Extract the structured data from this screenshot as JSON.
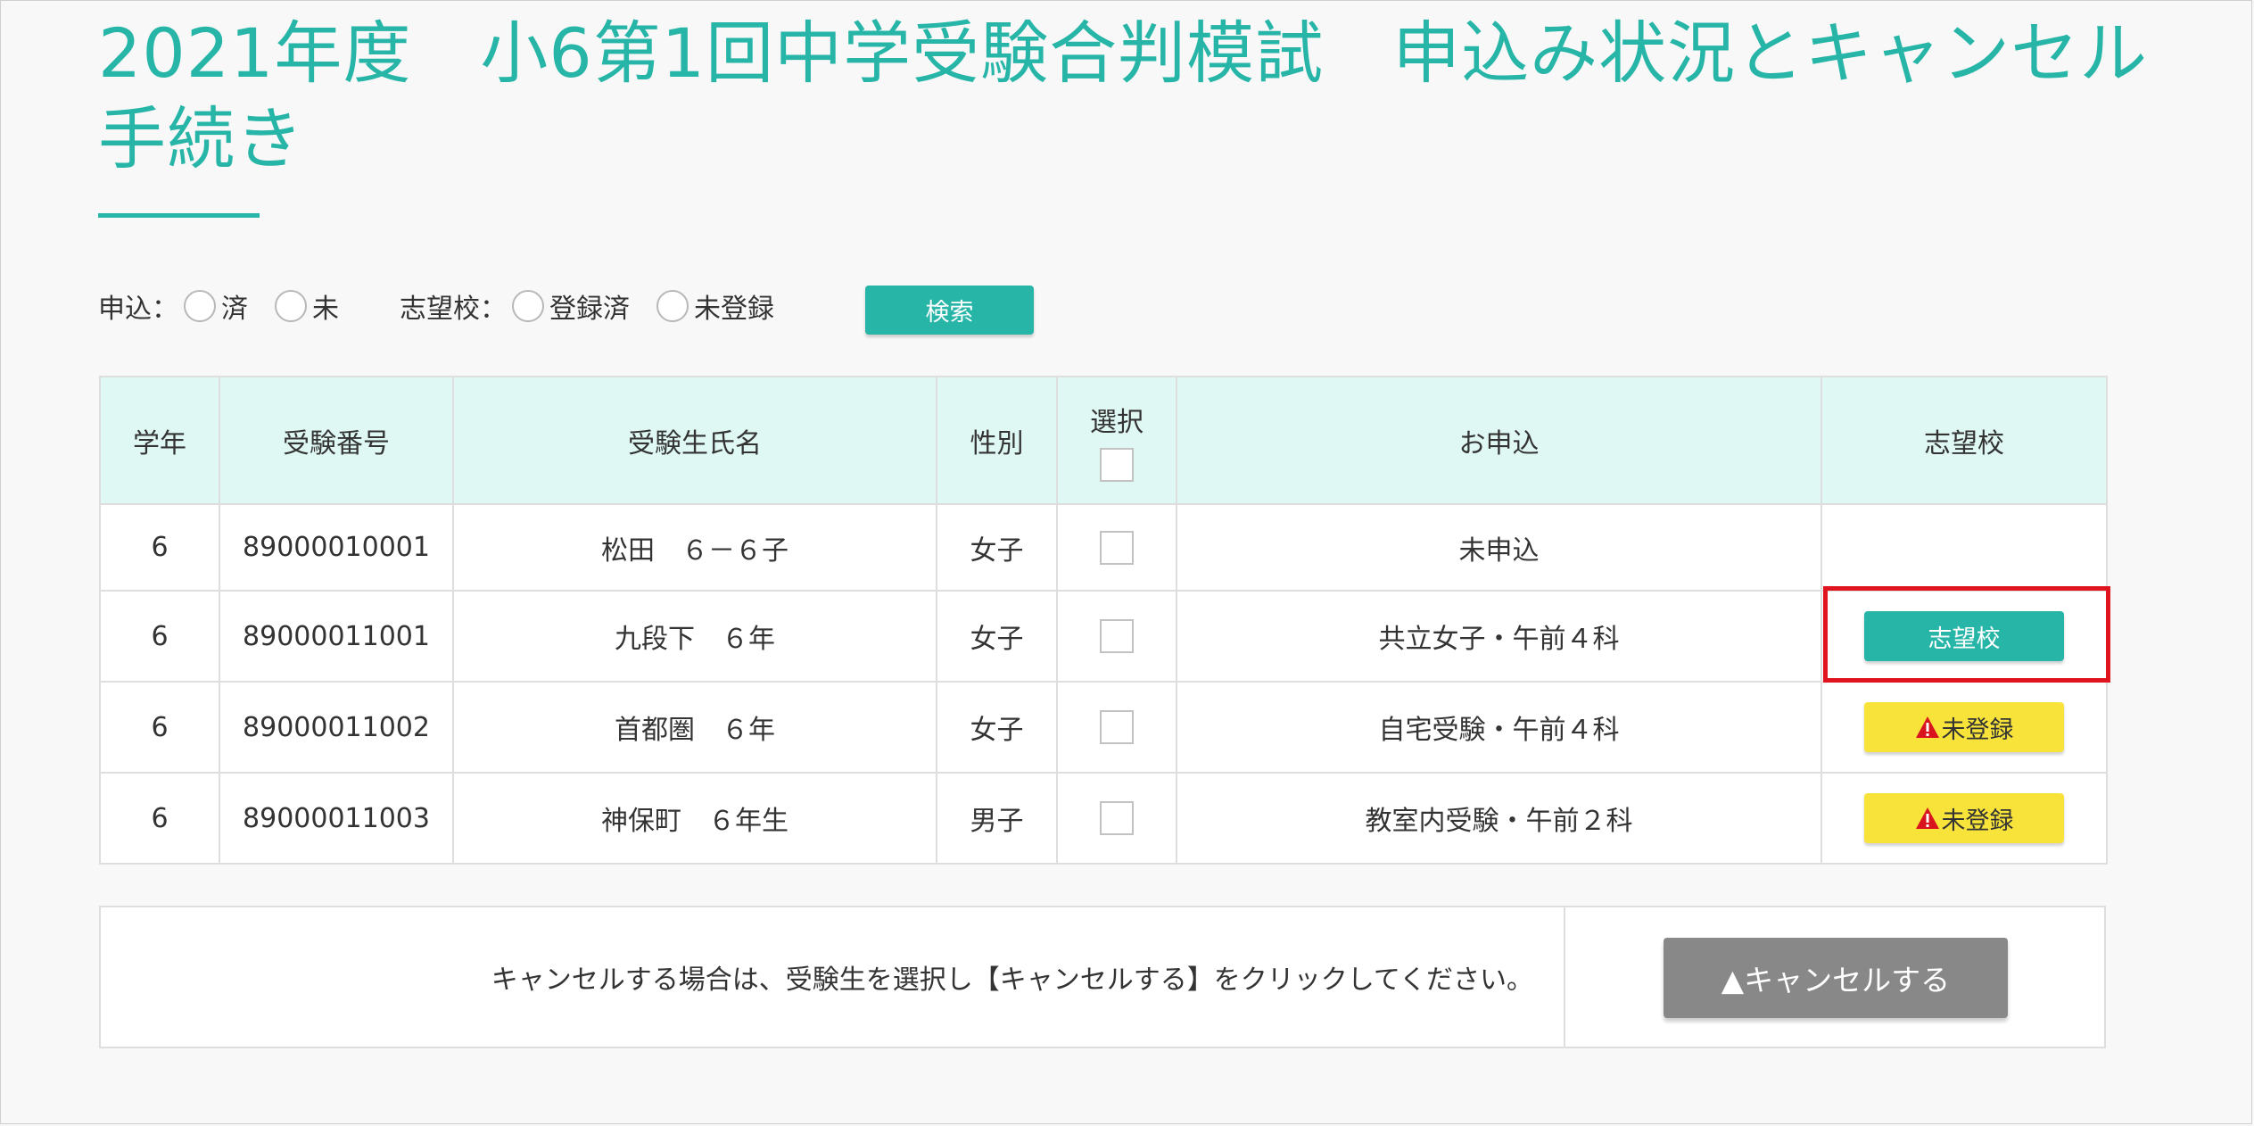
{
  "page": {
    "title": "2021年度　小6第1回中学受験合判模試　申込み状況とキャンセル手続き"
  },
  "filters": {
    "apply_label": "申込：",
    "apply_options": [
      "済",
      "未"
    ],
    "school_label": "志望校：",
    "school_options": [
      "登録済",
      "未登録"
    ],
    "search_button": "検索"
  },
  "table": {
    "headers": {
      "grade": "学年",
      "exam_no": "受験番号",
      "name": "受験生氏名",
      "gender": "性別",
      "select": "選択",
      "application": "お申込",
      "school": "志望校"
    },
    "rows": [
      {
        "grade": "6",
        "exam_no": "89000010001",
        "name": "松田　６－６子",
        "gender": "女子",
        "application": "未申込",
        "school_button": ""
      },
      {
        "grade": "6",
        "exam_no": "89000011001",
        "name": "九段下　６年",
        "gender": "女子",
        "application": "共立女子・午前４科",
        "school_button": "志望校"
      },
      {
        "grade": "6",
        "exam_no": "89000011002",
        "name": "首都圏　６年",
        "gender": "女子",
        "application": "自宅受験・午前４科",
        "school_button": "未登録"
      },
      {
        "grade": "6",
        "exam_no": "89000011003",
        "name": "神保町　６年生",
        "gender": "男子",
        "application": "教室内受験・午前２科",
        "school_button": "未登録"
      }
    ]
  },
  "cancel": {
    "message": "キャンセルする場合は、受験生を選択し【キャンセルする】をクリックしてください。",
    "button": "▲キャンセルする"
  },
  "colors": {
    "accent": "#27b5a8",
    "header_bg": "#dff8f3",
    "warning_bg": "#f8e33a",
    "warning_icon": "#d9141e",
    "cancel_button": "#888888",
    "highlight": "#e0141e"
  },
  "icons": {
    "warning": "warning-triangle-icon"
  }
}
